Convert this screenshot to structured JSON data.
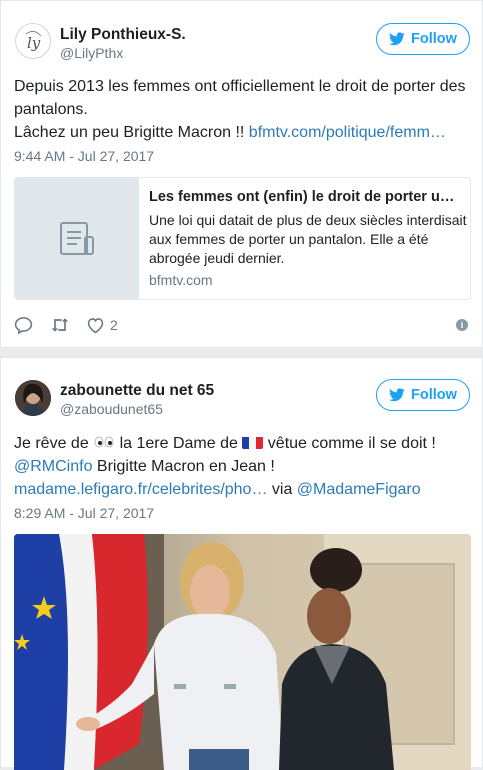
{
  "tweets": [
    {
      "author_name": "Lily Ponthieux-S.",
      "author_handle": "@LilyPthx",
      "follow_label": "Follow",
      "text_line1": "Depuis 2013 les femmes ont officiellement le droit de porter des pantalons.",
      "text_line2": "Lâchez un peu Brigitte Macron !! ",
      "link": "bfmtv.com/politique/femm…",
      "timestamp": "9:44 AM - Jul 27, 2017",
      "card": {
        "title": "Les femmes ont (enfin) le droit de porter u…",
        "description": "Une loi qui datait de plus de deux siècles interdisait aux femmes de porter un pantalon. Elle a été abrogée jeudi dernier.",
        "domain": "bfmtv.com"
      },
      "like_count": "2",
      "icons": [
        "reply-icon",
        "retweet-icon",
        "like-icon",
        "info-icon"
      ]
    },
    {
      "author_name": "zabounette du net 65",
      "author_handle": "@zaboudunet65",
      "follow_label": "Follow",
      "text_a": "Je rêve de ",
      "text_b": " la 1ere Dame de ",
      "text_c": " vêtue comme il se doit !",
      "mention1": "@RMCinfo",
      "text_d": " Brigitte Macron en Jean !",
      "link": "madame.lefigaro.fr/celebrites/pho…",
      "text_via": " via ",
      "mention2": "@MadameFigaro",
      "timestamp": "8:29 AM - Jul 27, 2017"
    }
  ],
  "colors": {
    "accent": "#1da1f2",
    "link": "#2b7bb9",
    "muted": "#697882"
  }
}
